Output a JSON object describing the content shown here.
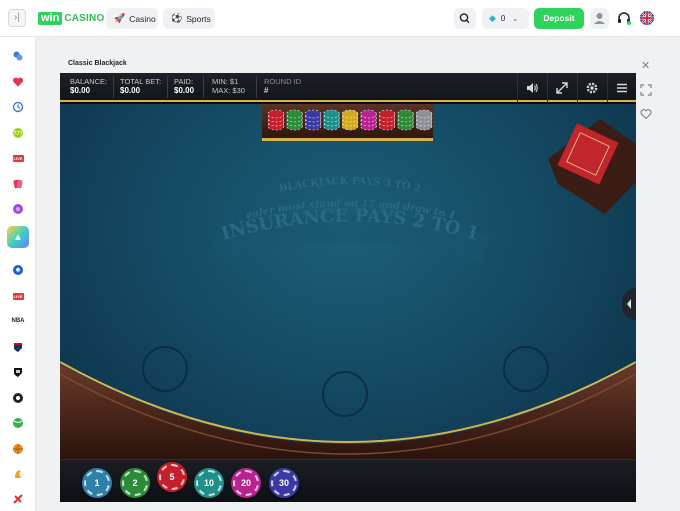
{
  "app": {
    "logo_win": "win",
    "logo_casino": "CASINO"
  },
  "nav": {
    "tabs": [
      {
        "label": "Casino",
        "icon": "rocket-icon"
      },
      {
        "label": "Sports",
        "icon": "soccer-ball-icon"
      }
    ]
  },
  "header": {
    "balance_value": "0",
    "deposit_label": "Deposit",
    "language": "en-GB"
  },
  "sidebar": {
    "items": [
      {
        "icon": "coins-icon"
      },
      {
        "icon": "heart-icon"
      },
      {
        "icon": "history-icon"
      },
      {
        "icon": "slots-icon"
      },
      {
        "icon": "live-icon",
        "label": "LIVE"
      },
      {
        "icon": "cards-icon"
      },
      {
        "icon": "dice-icon"
      },
      {
        "icon": "featured-game-icon"
      },
      {
        "icon": "soccer-icon"
      },
      {
        "icon": "live-sports-icon",
        "label": "LIVE"
      },
      {
        "icon": "nba-icon",
        "label": "NBA"
      },
      {
        "icon": "nfl-icon"
      },
      {
        "icon": "nhl-icon"
      },
      {
        "icon": "football-icon"
      },
      {
        "icon": "tennis-icon"
      },
      {
        "icon": "basketball-icon"
      },
      {
        "icon": "horse-racing-icon"
      },
      {
        "icon": "esports-icon"
      }
    ]
  },
  "game": {
    "title": "Classic Blackjack",
    "hud": {
      "balance_label": "BALANCE:",
      "balance_value": "$0.00",
      "total_bet_label": "TOTAL BET:",
      "total_bet_value": "$0.00",
      "paid_label": "PAID:",
      "paid_value": "$0.00",
      "min_label": "MIN: $1",
      "max_label": "MAX: $30",
      "round_id_label": "ROUND ID",
      "round_id_value": "#"
    },
    "table": {
      "line1": "BLACKJACK PAYS 3 TO 2",
      "line2": "Dealer must stand on 17 and draw to 16",
      "line3": "INSURANCE PAYS 2 TO 1"
    },
    "chips": [
      {
        "value": "1",
        "color": "#2f7fa8"
      },
      {
        "value": "2",
        "color": "#2c8a3a"
      },
      {
        "value": "5",
        "color": "#c41f2b"
      },
      {
        "value": "10",
        "color": "#1f8f8a"
      },
      {
        "value": "20",
        "color": "#b8248f"
      },
      {
        "value": "30",
        "color": "#3a3aa0"
      }
    ],
    "colors": {
      "felt": "#154b64",
      "accent_gold": "#d8b24a",
      "brand_green": "#2fd35b"
    }
  }
}
